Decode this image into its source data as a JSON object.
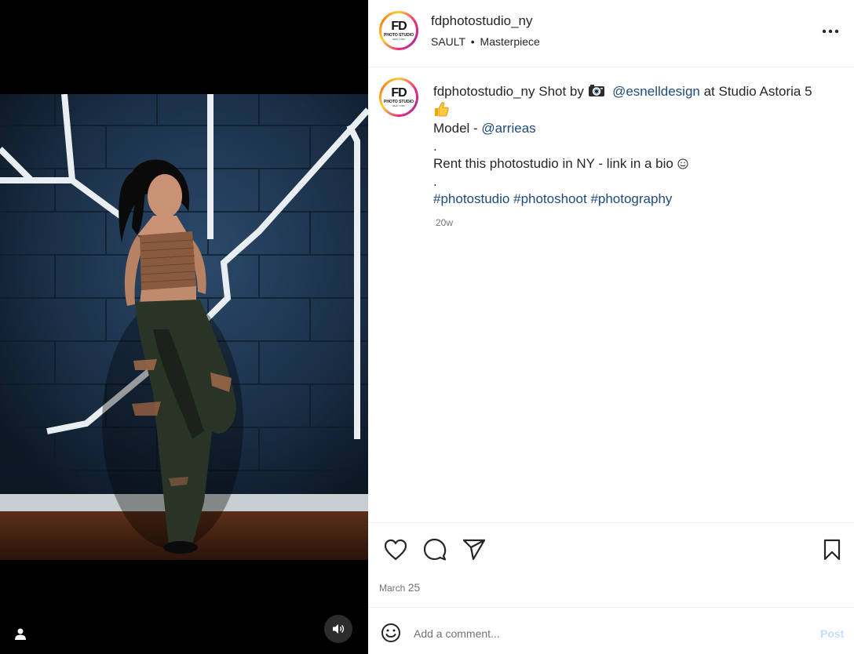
{
  "post": {
    "username": "fdphotostudio_ny",
    "audio_artist": "SAULT",
    "audio_separator": "•",
    "audio_title": "Masterpiece",
    "avatar_text": {
      "main": "FD",
      "sub": "PHOTO STUDIO",
      "tiny": "NEW YORK"
    },
    "caption": {
      "username": "fdphotostudio_ny",
      "shot_by": "Shot by",
      "camera_icon": "camera-icon",
      "photographer": "@esnelldesign",
      "location_text": "at Studio Astoria 5",
      "thumbs_icon": "thumbs-up-icon",
      "model_label": "Model -",
      "model_handle": "@arrieas",
      "dot1": ".",
      "rent_text": "Rent this photostudio in NY - link in a bio",
      "smile_icon": "smile-icon",
      "dot2": ".",
      "hashtags": [
        "#photostudio",
        "#photoshoot",
        "#photography"
      ]
    },
    "time_ago": "20w",
    "date_month": "March",
    "date_day": "25"
  },
  "actions": {
    "like": "heart-icon",
    "comment": "comment-icon",
    "share": "share-icon",
    "save": "bookmark-icon"
  },
  "comment_box": {
    "placeholder": "Add a comment...",
    "post_label": "Post"
  },
  "colors": {
    "link": "#1e4b7a",
    "muted": "#737373",
    "post_disabled": "#c0dffd"
  }
}
